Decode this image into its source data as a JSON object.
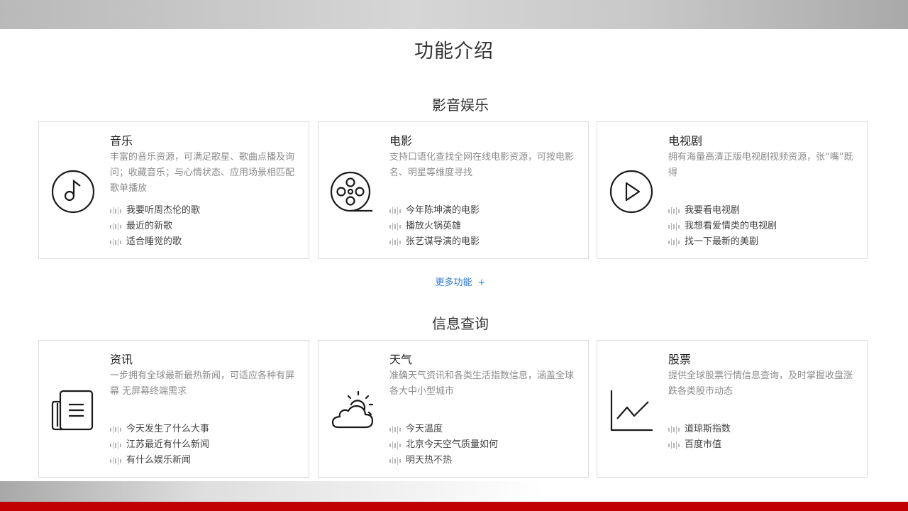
{
  "page": {
    "title": "功能介绍"
  },
  "sections": [
    {
      "title": "影音娱乐",
      "cards": [
        {
          "name": "音乐",
          "icon": "music-note-icon",
          "desc": "丰富的音乐资源，可满足歌星、歌曲点播及询问；收藏音乐；与心情状态、应用场景相匹配歌单播放",
          "examples": [
            "我要听周杰伦的歌",
            "最近的新歌",
            "适合睡觉的歌"
          ]
        },
        {
          "name": "电影",
          "icon": "film-reel-icon",
          "desc": "支持口语化查找全网在线电影资源，可按电影名、明星等维度寻找",
          "examples": [
            "今年陈坤演的电影",
            "播放火锅英雄",
            "张艺谋导演的电影"
          ]
        },
        {
          "name": "电视剧",
          "icon": "play-circle-icon",
          "desc": "拥有海量高清正版电视剧视频资源，张“嘴”既得",
          "examples": [
            "我要看电视剧",
            "我想看爱情类的电视剧",
            "找一下最新的美剧"
          ]
        }
      ]
    },
    {
      "title": "信息查询",
      "cards": [
        {
          "name": "资讯",
          "icon": "newspaper-icon",
          "desc": "一步拥有全球最新最热新闻，可适应各种有屏幕 无屏幕终端需求",
          "examples": [
            "今天发生了什么大事",
            "江苏最近有什么新闻",
            "有什么娱乐新闻"
          ]
        },
        {
          "name": "天气",
          "icon": "sun-cloud-icon",
          "desc": "准确天气资讯和各类生活指数信息，涵盖全球各大中小型城市",
          "examples": [
            "今天温度",
            "北京今天空气质量如何",
            "明天热不热"
          ]
        },
        {
          "name": "股票",
          "icon": "stock-chart-icon",
          "desc": "提供全球股票行情信息查询，及时掌握收盘涨跌各类股市动态",
          "examples": [
            "道琼斯指数",
            "百度市值"
          ]
        }
      ]
    }
  ],
  "more": {
    "label": "更多功能",
    "plus": "+"
  },
  "colors": {
    "accent_link": "#2a7bd8",
    "footer_red": "#c00000"
  }
}
